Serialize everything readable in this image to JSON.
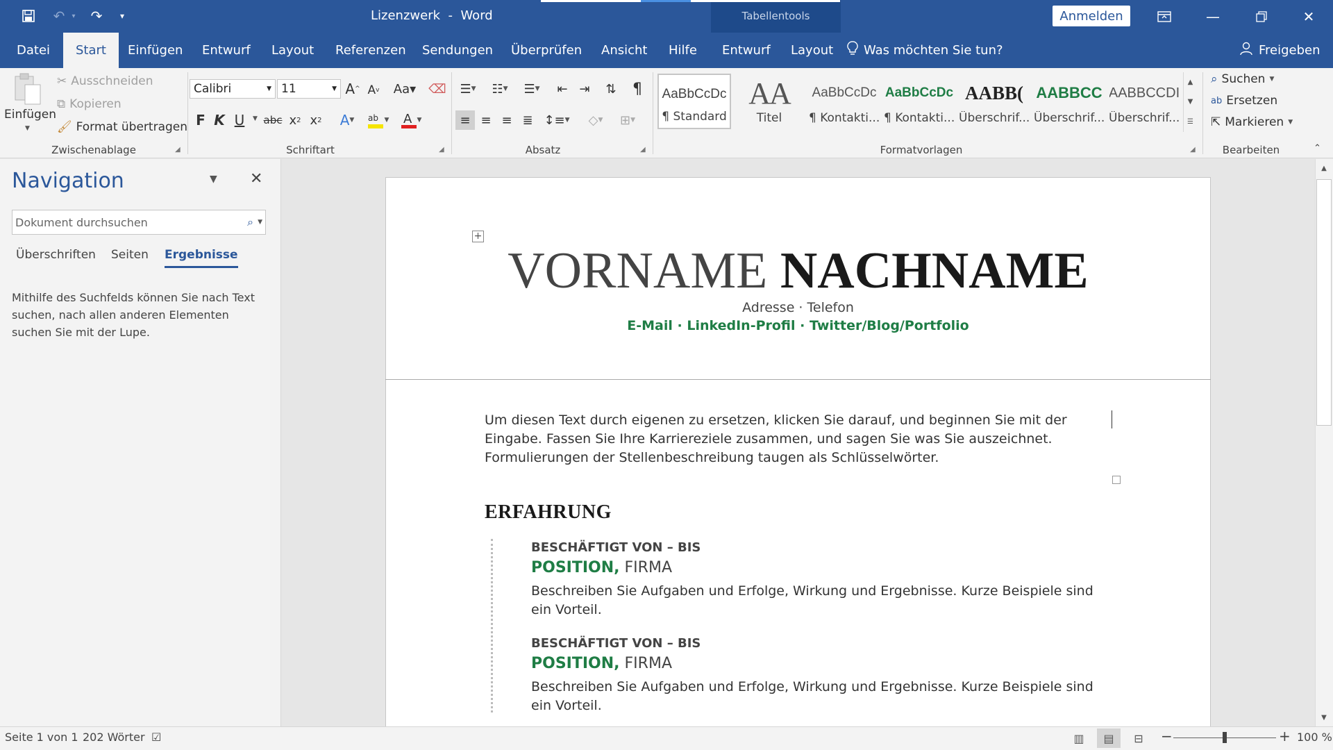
{
  "window": {
    "doc_name": "Lizenzwerk",
    "separator": "-",
    "app_name": "Word",
    "context_tab_group": "Tabellentools",
    "sign_in_label": "Anmelden"
  },
  "tabs": [
    {
      "label": "Datei"
    },
    {
      "label": "Start"
    },
    {
      "label": "Einfügen"
    },
    {
      "label": "Entwurf"
    },
    {
      "label": "Layout"
    },
    {
      "label": "Referenzen"
    },
    {
      "label": "Sendungen"
    },
    {
      "label": "Überprüfen"
    },
    {
      "label": "Ansicht"
    },
    {
      "label": "Hilfe"
    },
    {
      "label": "Entwurf"
    },
    {
      "label": "Layout"
    }
  ],
  "tell_me": "Was möchten Sie tun?",
  "share_label": "Freigeben",
  "ribbon": {
    "clipboard": {
      "paste": "Einfügen",
      "cut": "Ausschneiden",
      "copy": "Kopieren",
      "format_painter": "Format übertragen",
      "label": "Zwischenablage"
    },
    "font": {
      "family": "Calibri",
      "size": "11",
      "bold": "F",
      "italic": "K",
      "underline": "U",
      "strike": "abc",
      "label": "Schriftart"
    },
    "paragraph": {
      "label": "Absatz"
    },
    "styles": {
      "label": "Formatvorlagen",
      "items": [
        {
          "preview": "AaBbCcDc",
          "name": "¶ Standard"
        },
        {
          "preview": "AA",
          "name": "Titel"
        },
        {
          "preview": "AaBbCcDc",
          "name": "¶ Kontakti..."
        },
        {
          "preview": "AaBbCcDc",
          "name": "¶ Kontakti..."
        },
        {
          "preview": "AABB(",
          "name": "Überschrif..."
        },
        {
          "preview": "AABBCC",
          "name": "Überschrif..."
        },
        {
          "preview": "AABBCCDI",
          "name": "Überschrif..."
        }
      ]
    },
    "editing": {
      "find": "Suchen",
      "replace": "Ersetzen",
      "select": "Markieren",
      "label": "Bearbeiten"
    }
  },
  "navigation": {
    "title": "Navigation",
    "search_placeholder": "Dokument durchsuchen",
    "tabs": [
      {
        "label": "Überschriften"
      },
      {
        "label": "Seiten"
      },
      {
        "label": "Ergebnisse"
      }
    ],
    "hint": "Mithilfe des Suchfelds können Sie nach Text suchen, nach allen anderen Elementen suchen Sie mit der Lupe."
  },
  "document": {
    "first_name": "VORNAME",
    "last_name": "NACHNAME",
    "contact_line1": "Adresse · Telefon",
    "contact_line2": "E-Mail · LinkedIn-Profil · Twitter/Blog/Portfolio",
    "intro": "Um diesen Text durch eigenen zu ersetzen, klicken Sie darauf, und beginnen Sie mit der Eingabe. Fassen Sie Ihre Karriereziele zusammen, und sagen Sie was Sie auszeichnet. Formulierungen der Stellenbeschreibung taugen als Schlüsselwörter.",
    "experience_heading": "ERFAHRUNG",
    "jobs": [
      {
        "dates": "BESCHÄFTIGT VON – BIS",
        "position": "POSITION,",
        "company": "FIRMA",
        "description": "Beschreiben Sie Aufgaben und Erfolge, Wirkung und Ergebnisse. Kurze Beispiele sind ein Vorteil."
      },
      {
        "dates": "BESCHÄFTIGT VON – BIS",
        "position": "POSITION,",
        "company": "FIRMA",
        "description": "Beschreiben Sie Aufgaben und Erfolge, Wirkung und Ergebnisse. Kurze Beispiele sind ein Vorteil."
      }
    ]
  },
  "status": {
    "page": "Seite 1 von 1",
    "words": "202 Wörter",
    "zoom": "100 %"
  },
  "colors": {
    "accent": "#2b579a",
    "green": "#1f7d45"
  }
}
